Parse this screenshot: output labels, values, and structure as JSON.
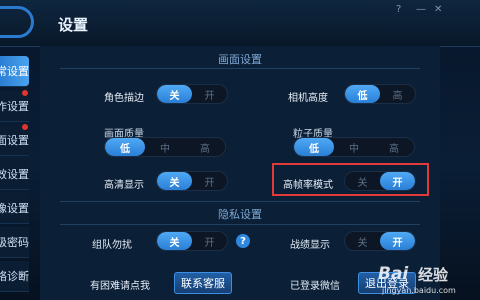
{
  "window": {
    "title": "设置",
    "controls": [
      "?",
      "—",
      "✕"
    ]
  },
  "sidebar": {
    "items": [
      {
        "label": "常设置",
        "active": true,
        "badge": false
      },
      {
        "label": "作设置",
        "active": false,
        "badge": true
      },
      {
        "label": "面设置",
        "active": false,
        "badge": true
      },
      {
        "label": "效设置",
        "active": false,
        "badge": false
      },
      {
        "label": "像设置",
        "active": false,
        "badge": false
      },
      {
        "label": "级密码",
        "active": false,
        "badge": false
      },
      {
        "label": "络诊断",
        "active": false,
        "badge": false
      }
    ]
  },
  "graphics": {
    "section_title": "画面设置",
    "role_outline": {
      "label": "角色描边",
      "options": [
        "关",
        "开"
      ],
      "selected": "关"
    },
    "camera_height": {
      "label": "相机高度",
      "options": [
        "低",
        "高"
      ],
      "selected": "低"
    },
    "picture_quality": {
      "label": "画面质量",
      "options": [
        "低",
        "中",
        "高"
      ],
      "selected": "低"
    },
    "particle_quality": {
      "label": "粒子质量",
      "options": [
        "低",
        "中",
        "高"
      ],
      "selected": "低"
    },
    "hd_display": {
      "label": "高清显示",
      "options": [
        "关",
        "开"
      ],
      "selected": "关"
    },
    "high_fps": {
      "label": "高帧率模式",
      "options": [
        "关",
        "开"
      ],
      "selected": "开"
    }
  },
  "privacy": {
    "section_title": "隐私设置",
    "team_no_disturb": {
      "label": "组队勿扰",
      "options": [
        "关",
        "开"
      ],
      "selected": "关",
      "help": "?"
    },
    "record_display": {
      "label": "战绩显示",
      "options": [
        "关",
        "开"
      ],
      "selected": "开"
    }
  },
  "footer": {
    "trouble_text": "有困难请点我",
    "contact_button": "联系客服",
    "wechat_text": "已登录微信",
    "logout_button": "退出登录"
  },
  "watermark": {
    "brand": "Bai",
    "brand2": "经验",
    "url": "jingyan.baidu.com"
  },
  "colors": {
    "accent": "#2f88e0",
    "highlight_border": "#e03a3a"
  }
}
